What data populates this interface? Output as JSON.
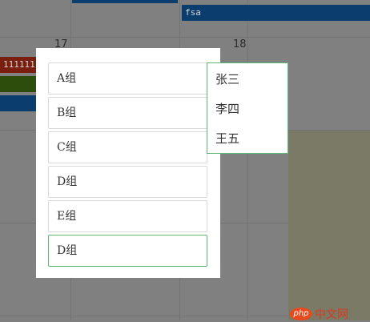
{
  "calendar": {
    "day_17": "17",
    "day_18": "18",
    "events": {
      "top_event": "fsa",
      "red_event": "1111111"
    }
  },
  "groups": [
    {
      "label": "A组"
    },
    {
      "label": "B组"
    },
    {
      "label": "C组"
    },
    {
      "label": "D组"
    },
    {
      "label": "E组"
    },
    {
      "label": "D组"
    }
  ],
  "members": [
    {
      "label": "张三"
    },
    {
      "label": "李四"
    },
    {
      "label": "王五"
    }
  ],
  "watermark": {
    "logo": "php",
    "text": "中文网"
  },
  "colors": {
    "active_border": "#5fb878",
    "event_blue": "#0b3d6e",
    "event_red": "#7a1e10",
    "event_green": "#2c4d0c"
  }
}
